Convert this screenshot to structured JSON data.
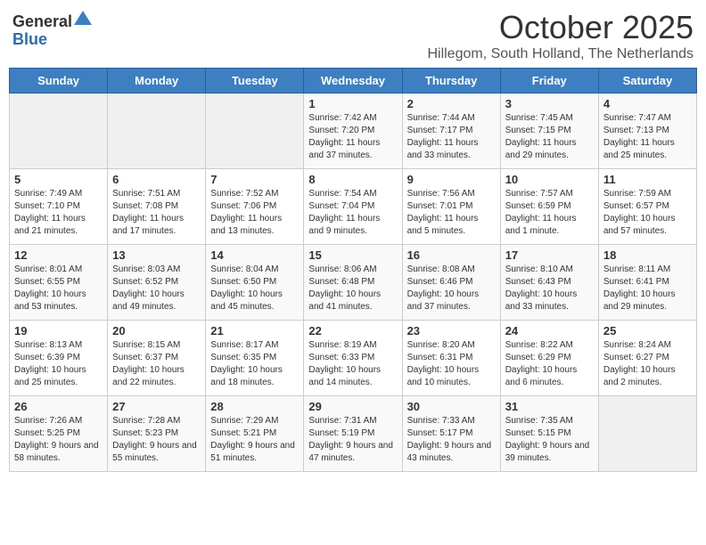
{
  "logo": {
    "general": "General",
    "blue": "Blue"
  },
  "header": {
    "month": "October 2025",
    "location": "Hillegom, South Holland, The Netherlands"
  },
  "days_of_week": [
    "Sunday",
    "Monday",
    "Tuesday",
    "Wednesday",
    "Thursday",
    "Friday",
    "Saturday"
  ],
  "weeks": [
    [
      {
        "day": "",
        "sunrise": "",
        "sunset": "",
        "daylight": ""
      },
      {
        "day": "",
        "sunrise": "",
        "sunset": "",
        "daylight": ""
      },
      {
        "day": "",
        "sunrise": "",
        "sunset": "",
        "daylight": ""
      },
      {
        "day": "1",
        "sunrise": "Sunrise: 7:42 AM",
        "sunset": "Sunset: 7:20 PM",
        "daylight": "Daylight: 11 hours and 37 minutes."
      },
      {
        "day": "2",
        "sunrise": "Sunrise: 7:44 AM",
        "sunset": "Sunset: 7:17 PM",
        "daylight": "Daylight: 11 hours and 33 minutes."
      },
      {
        "day": "3",
        "sunrise": "Sunrise: 7:45 AM",
        "sunset": "Sunset: 7:15 PM",
        "daylight": "Daylight: 11 hours and 29 minutes."
      },
      {
        "day": "4",
        "sunrise": "Sunrise: 7:47 AM",
        "sunset": "Sunset: 7:13 PM",
        "daylight": "Daylight: 11 hours and 25 minutes."
      }
    ],
    [
      {
        "day": "5",
        "sunrise": "Sunrise: 7:49 AM",
        "sunset": "Sunset: 7:10 PM",
        "daylight": "Daylight: 11 hours and 21 minutes."
      },
      {
        "day": "6",
        "sunrise": "Sunrise: 7:51 AM",
        "sunset": "Sunset: 7:08 PM",
        "daylight": "Daylight: 11 hours and 17 minutes."
      },
      {
        "day": "7",
        "sunrise": "Sunrise: 7:52 AM",
        "sunset": "Sunset: 7:06 PM",
        "daylight": "Daylight: 11 hours and 13 minutes."
      },
      {
        "day": "8",
        "sunrise": "Sunrise: 7:54 AM",
        "sunset": "Sunset: 7:04 PM",
        "daylight": "Daylight: 11 hours and 9 minutes."
      },
      {
        "day": "9",
        "sunrise": "Sunrise: 7:56 AM",
        "sunset": "Sunset: 7:01 PM",
        "daylight": "Daylight: 11 hours and 5 minutes."
      },
      {
        "day": "10",
        "sunrise": "Sunrise: 7:57 AM",
        "sunset": "Sunset: 6:59 PM",
        "daylight": "Daylight: 11 hours and 1 minute."
      },
      {
        "day": "11",
        "sunrise": "Sunrise: 7:59 AM",
        "sunset": "Sunset: 6:57 PM",
        "daylight": "Daylight: 10 hours and 57 minutes."
      }
    ],
    [
      {
        "day": "12",
        "sunrise": "Sunrise: 8:01 AM",
        "sunset": "Sunset: 6:55 PM",
        "daylight": "Daylight: 10 hours and 53 minutes."
      },
      {
        "day": "13",
        "sunrise": "Sunrise: 8:03 AM",
        "sunset": "Sunset: 6:52 PM",
        "daylight": "Daylight: 10 hours and 49 minutes."
      },
      {
        "day": "14",
        "sunrise": "Sunrise: 8:04 AM",
        "sunset": "Sunset: 6:50 PM",
        "daylight": "Daylight: 10 hours and 45 minutes."
      },
      {
        "day": "15",
        "sunrise": "Sunrise: 8:06 AM",
        "sunset": "Sunset: 6:48 PM",
        "daylight": "Daylight: 10 hours and 41 minutes."
      },
      {
        "day": "16",
        "sunrise": "Sunrise: 8:08 AM",
        "sunset": "Sunset: 6:46 PM",
        "daylight": "Daylight: 10 hours and 37 minutes."
      },
      {
        "day": "17",
        "sunrise": "Sunrise: 8:10 AM",
        "sunset": "Sunset: 6:43 PM",
        "daylight": "Daylight: 10 hours and 33 minutes."
      },
      {
        "day": "18",
        "sunrise": "Sunrise: 8:11 AM",
        "sunset": "Sunset: 6:41 PM",
        "daylight": "Daylight: 10 hours and 29 minutes."
      }
    ],
    [
      {
        "day": "19",
        "sunrise": "Sunrise: 8:13 AM",
        "sunset": "Sunset: 6:39 PM",
        "daylight": "Daylight: 10 hours and 25 minutes."
      },
      {
        "day": "20",
        "sunrise": "Sunrise: 8:15 AM",
        "sunset": "Sunset: 6:37 PM",
        "daylight": "Daylight: 10 hours and 22 minutes."
      },
      {
        "day": "21",
        "sunrise": "Sunrise: 8:17 AM",
        "sunset": "Sunset: 6:35 PM",
        "daylight": "Daylight: 10 hours and 18 minutes."
      },
      {
        "day": "22",
        "sunrise": "Sunrise: 8:19 AM",
        "sunset": "Sunset: 6:33 PM",
        "daylight": "Daylight: 10 hours and 14 minutes."
      },
      {
        "day": "23",
        "sunrise": "Sunrise: 8:20 AM",
        "sunset": "Sunset: 6:31 PM",
        "daylight": "Daylight: 10 hours and 10 minutes."
      },
      {
        "day": "24",
        "sunrise": "Sunrise: 8:22 AM",
        "sunset": "Sunset: 6:29 PM",
        "daylight": "Daylight: 10 hours and 6 minutes."
      },
      {
        "day": "25",
        "sunrise": "Sunrise: 8:24 AM",
        "sunset": "Sunset: 6:27 PM",
        "daylight": "Daylight: 10 hours and 2 minutes."
      }
    ],
    [
      {
        "day": "26",
        "sunrise": "Sunrise: 7:26 AM",
        "sunset": "Sunset: 5:25 PM",
        "daylight": "Daylight: 9 hours and 58 minutes."
      },
      {
        "day": "27",
        "sunrise": "Sunrise: 7:28 AM",
        "sunset": "Sunset: 5:23 PM",
        "daylight": "Daylight: 9 hours and 55 minutes."
      },
      {
        "day": "28",
        "sunrise": "Sunrise: 7:29 AM",
        "sunset": "Sunset: 5:21 PM",
        "daylight": "Daylight: 9 hours and 51 minutes."
      },
      {
        "day": "29",
        "sunrise": "Sunrise: 7:31 AM",
        "sunset": "Sunset: 5:19 PM",
        "daylight": "Daylight: 9 hours and 47 minutes."
      },
      {
        "day": "30",
        "sunrise": "Sunrise: 7:33 AM",
        "sunset": "Sunset: 5:17 PM",
        "daylight": "Daylight: 9 hours and 43 minutes."
      },
      {
        "day": "31",
        "sunrise": "Sunrise: 7:35 AM",
        "sunset": "Sunset: 5:15 PM",
        "daylight": "Daylight: 9 hours and 39 minutes."
      },
      {
        "day": "",
        "sunrise": "",
        "sunset": "",
        "daylight": ""
      }
    ]
  ]
}
